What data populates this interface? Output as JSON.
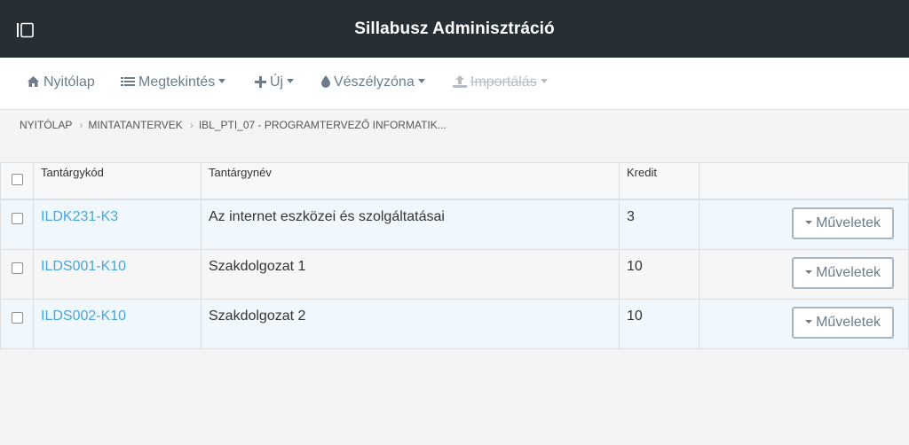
{
  "header": {
    "title": "Sillabusz Adminisztráció",
    "toggle_icon": "sidebar-toggle-icon"
  },
  "menu": {
    "home": "Nyitólap",
    "view": "Megtekintés",
    "new": "Új",
    "danger": "Vészélyzóna",
    "import": "Importálás"
  },
  "breadcrumb": {
    "items": [
      "NYITÓLAP",
      "MINTATANTERVEK",
      "IBL_PTI_07 - PROGRAMTERVEZŐ INFORMATIK..."
    ]
  },
  "table": {
    "headers": {
      "code": "Tantárgykód",
      "name": "Tantárgynév",
      "credit": "Kredit"
    },
    "rows": [
      {
        "code": "ILDK231-K3",
        "name": "Az internet eszközei és szolgáltatásai",
        "credit": "3",
        "action": "Műveletek"
      },
      {
        "code": "ILDS001-K10",
        "name": "Szakdolgozat 1",
        "credit": "10",
        "action": "Műveletek"
      },
      {
        "code": "ILDS002-K10",
        "name": "Szakdolgozat 2",
        "credit": "10",
        "action": "Műveletek"
      }
    ]
  },
  "colors": {
    "topbar": "#262e36",
    "link": "#4ba6d8",
    "menu_text": "#6b7d8c"
  }
}
